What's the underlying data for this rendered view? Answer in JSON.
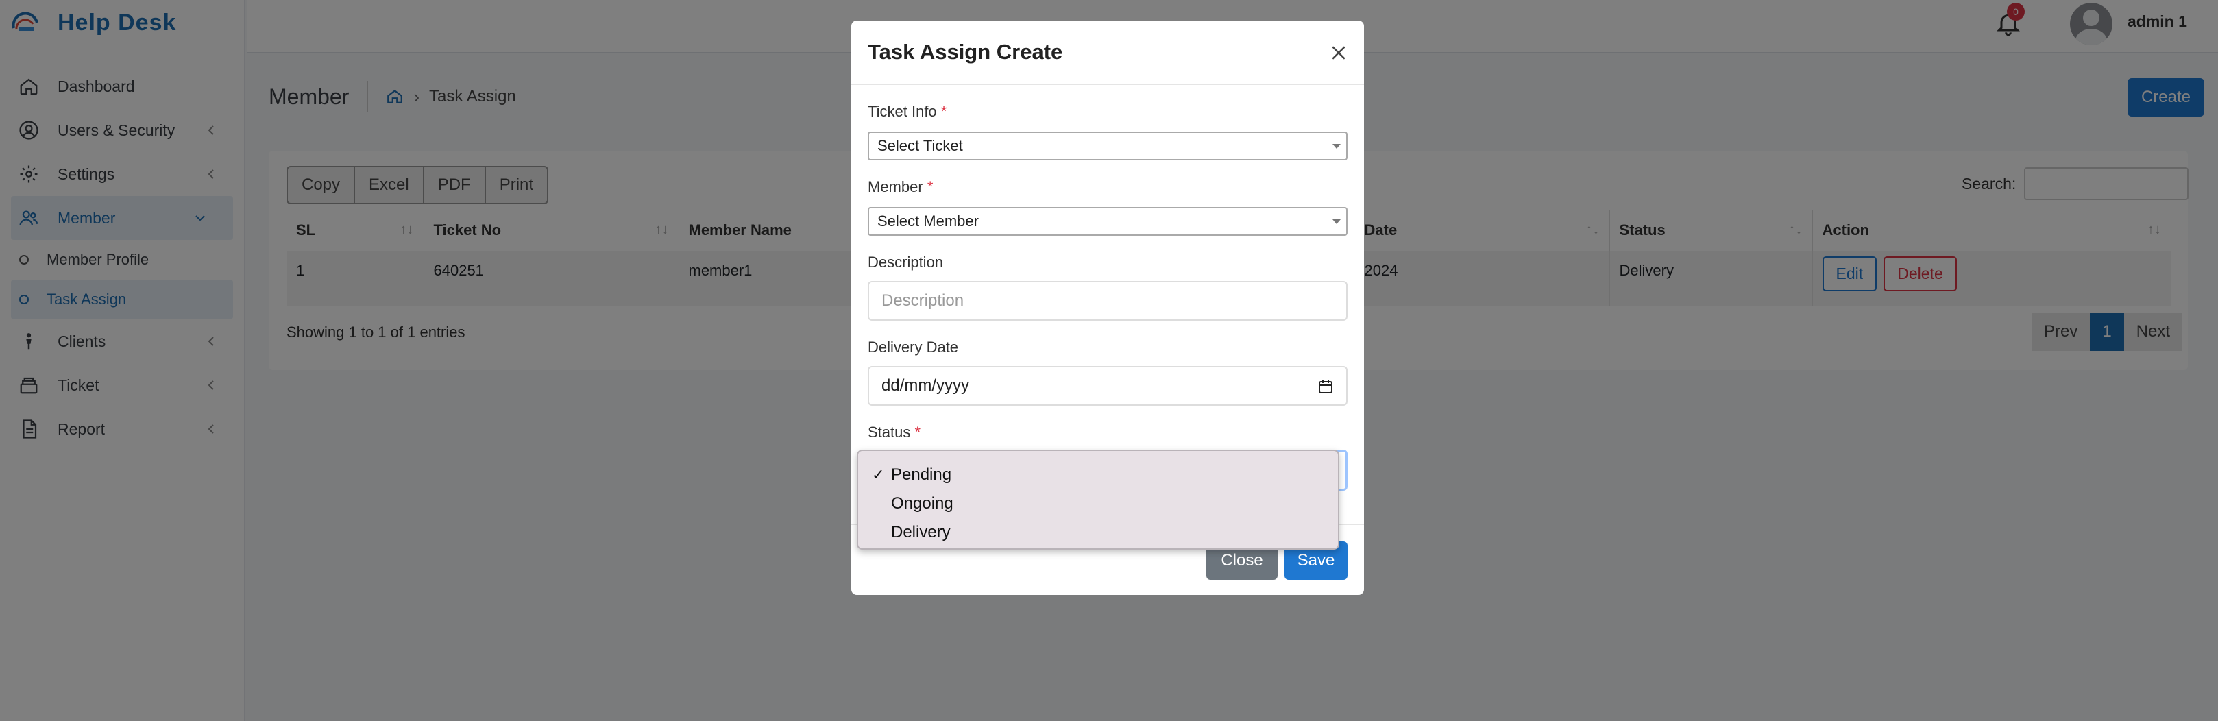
{
  "app": {
    "brand": "Help Desk"
  },
  "sidebar": {
    "items": [
      {
        "label": "Dashboard",
        "icon": "home-icon"
      },
      {
        "label": "Users & Security",
        "icon": "user-circle-icon"
      },
      {
        "label": "Settings",
        "icon": "gear-icon"
      },
      {
        "label": "Member",
        "icon": "users-icon"
      },
      {
        "label": "Clients",
        "icon": "person-icon"
      },
      {
        "label": "Ticket",
        "icon": "inbox-icon"
      },
      {
        "label": "Report",
        "icon": "document-icon"
      }
    ],
    "member_sub": [
      {
        "label": "Member Profile"
      },
      {
        "label": "Task Assign"
      }
    ]
  },
  "header": {
    "notification_count": "0",
    "username": "admin 1"
  },
  "page": {
    "title": "Member",
    "breadcrumb": "Task Assign",
    "create_label": "Create"
  },
  "table": {
    "export_buttons": [
      "Copy",
      "Excel",
      "PDF",
      "Print"
    ],
    "search_label": "Search:",
    "columns": [
      "SL",
      "Ticket No",
      "Member Name",
      "Date",
      "Status",
      "Action"
    ],
    "rows": [
      {
        "sl": "1",
        "ticket_no": "640251",
        "member": "member1",
        "date": "2024",
        "status": "Delivery"
      }
    ],
    "edit_label": "Edit",
    "delete_label": "Delete",
    "info": "Showing 1 to 1 of 1 entries",
    "pager": {
      "prev": "Prev",
      "current": "1",
      "next": "Next"
    }
  },
  "modal": {
    "title": "Task Assign Create",
    "ticket_label": "Ticket Info",
    "ticket_value": "Select Ticket",
    "member_label": "Member",
    "member_value": "Select Member",
    "description_label": "Description",
    "description_placeholder": "Description",
    "date_label": "Delivery Date",
    "date_placeholder": "dd/mm/yyyy",
    "status_label": "Status",
    "required_mark": "*",
    "close_label": "Close",
    "save_label": "Save"
  },
  "status_dropdown": {
    "options": [
      "Pending",
      "Ongoing",
      "Delivery"
    ],
    "selected": "Pending",
    "check_mark": "✓"
  },
  "colors": {
    "brand": "#1f6fb2",
    "primary_button": "#1f78d1",
    "danger": "#dc3545",
    "secondary": "#6c757d"
  }
}
